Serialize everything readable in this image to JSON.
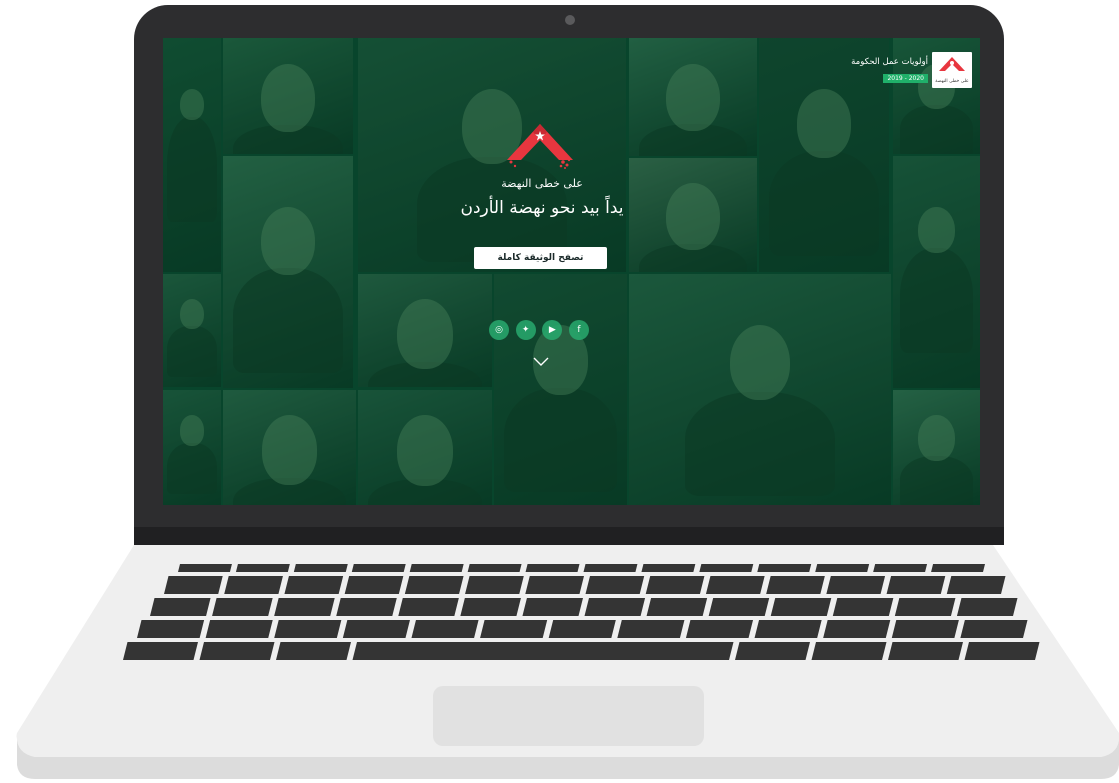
{
  "hero": {
    "tagline": "على خطى النهضة",
    "headline": "يداً بيد نحو نهضة الأردن",
    "cta_label": "تصفح الوثيقة كاملة"
  },
  "brand": {
    "title": "أولويات عمل الحكومة",
    "years": "2019 - 2020",
    "logo_caption": "على خطى النهضة"
  },
  "social": [
    {
      "name": "instagram-icon",
      "glyph": "◎"
    },
    {
      "name": "twitter-icon",
      "glyph": "✦"
    },
    {
      "name": "youtube-icon",
      "glyph": "▶"
    },
    {
      "name": "facebook-icon",
      "glyph": "f"
    }
  ],
  "colors": {
    "overlay_tint": "#00502d",
    "accent_red": "#e8363f",
    "accent_green": "#20b06a",
    "laptop_frame": "#2d2d2f",
    "laptop_base": "#efefef",
    "keys": "#333333"
  }
}
